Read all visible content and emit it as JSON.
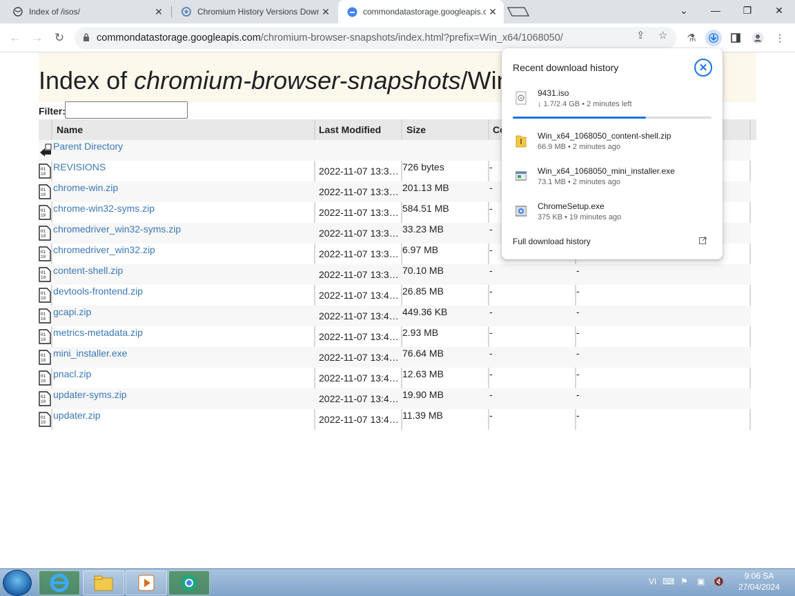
{
  "tabs": [
    {
      "title": "Index of /isos/",
      "icon": "page-icon",
      "active": false
    },
    {
      "title": "Chromium History Versions Downlo",
      "icon": "chrome-favicon",
      "active": false
    },
    {
      "title": "commondatastorage.googleapis.co",
      "icon": "google-cloud-icon",
      "active": true
    }
  ],
  "toolbar": {
    "url_host": "commondatastorage.googleapis.com",
    "url_path": "/chromium-browser-snapshots/index.html?prefix=Win_x64/1068050/"
  },
  "page": {
    "heading_prefix": "Index of ",
    "heading_italic": "chromium-browser-snapshots",
    "heading_suffix": "/Win",
    "filter_label": "Filter:",
    "columns": [
      "Name",
      "Last Modified",
      "Size",
      "Co"
    ],
    "rows": [
      {
        "name": "Parent Directory",
        "modified": "",
        "size": "",
        "c4": "",
        "c5": "",
        "icon": "parent-dir-icon"
      },
      {
        "name": "REVISIONS",
        "modified": "2022-11-07 13:3…",
        "size": "726 bytes",
        "c4": "-",
        "c5": "",
        "icon": "binary-file-icon"
      },
      {
        "name": "chrome-win.zip",
        "modified": "2022-11-07 13:3…",
        "size": "201.13 MB",
        "c4": "-",
        "c5": "",
        "icon": "binary-file-icon"
      },
      {
        "name": "chrome-win32-syms.zip",
        "modified": "2022-11-07 13:3…",
        "size": "584.51 MB",
        "c4": "-",
        "c5": "",
        "icon": "binary-file-icon"
      },
      {
        "name": "chromedriver_win32-syms.zip",
        "modified": "2022-11-07 13:3…",
        "size": "33.23 MB",
        "c4": "-",
        "c5": "",
        "icon": "binary-file-icon"
      },
      {
        "name": "chromedriver_win32.zip",
        "modified": "2022-11-07 13:3…",
        "size": "6.97 MB",
        "c4": "-",
        "c5": "",
        "icon": "binary-file-icon"
      },
      {
        "name": "content-shell.zip",
        "modified": "2022-11-07 13:3…",
        "size": "70.10 MB",
        "c4": "-",
        "c5": "-",
        "icon": "binary-file-icon"
      },
      {
        "name": "devtools-frontend.zip",
        "modified": "2022-11-07 13:4…",
        "size": "26.85 MB",
        "c4": "-",
        "c5": "-",
        "icon": "binary-file-icon"
      },
      {
        "name": "gcapi.zip",
        "modified": "2022-11-07 13:4…",
        "size": "449.36 KB",
        "c4": "-",
        "c5": "-",
        "icon": "binary-file-icon"
      },
      {
        "name": "metrics-metadata.zip",
        "modified": "2022-11-07 13:4…",
        "size": "2.93 MB",
        "c4": "-",
        "c5": "-",
        "icon": "binary-file-icon"
      },
      {
        "name": "mini_installer.exe",
        "modified": "2022-11-07 13:4…",
        "size": "76.64 MB",
        "c4": "-",
        "c5": "-",
        "icon": "binary-file-icon"
      },
      {
        "name": "pnacl.zip",
        "modified": "2022-11-07 13:4…",
        "size": "12.63 MB",
        "c4": "-",
        "c5": "-",
        "icon": "binary-file-icon"
      },
      {
        "name": "updater-syms.zip",
        "modified": "2022-11-07 13:4…",
        "size": "19.90 MB",
        "c4": "-",
        "c5": "-",
        "icon": "binary-file-icon"
      },
      {
        "name": "updater.zip",
        "modified": "2022-11-07 13:4…",
        "size": "11.39 MB",
        "c4": "-",
        "c5": "-",
        "icon": "binary-file-icon"
      }
    ]
  },
  "downloads": {
    "title": "Recent download history",
    "items": [
      {
        "name": "9431.iso",
        "status": "↓ 1.7/2.4 GB • 2 minutes left",
        "icon": "disc-image-icon",
        "progress": 0.67
      },
      {
        "name": "Win_x64_1068050_content-shell.zip",
        "status": "66.9 MB • 2 minutes ago",
        "icon": "zip-file-icon"
      },
      {
        "name": "Win_x64_1068050_mini_installer.exe",
        "status": "73.1 MB • 2 minutes ago",
        "icon": "exe-file-icon"
      },
      {
        "name": "ChromeSetup.exe",
        "status": "375 KB • 19 minutes ago",
        "icon": "installer-icon"
      }
    ],
    "full_history": "Full download history"
  },
  "taskbar": {
    "lang": "VI",
    "time": "9:06 SA",
    "date": "27/04/2024"
  },
  "colors": {
    "link": "#3b78b9",
    "accent": "#1a73e8",
    "heading_band": "#fdf8ec"
  }
}
